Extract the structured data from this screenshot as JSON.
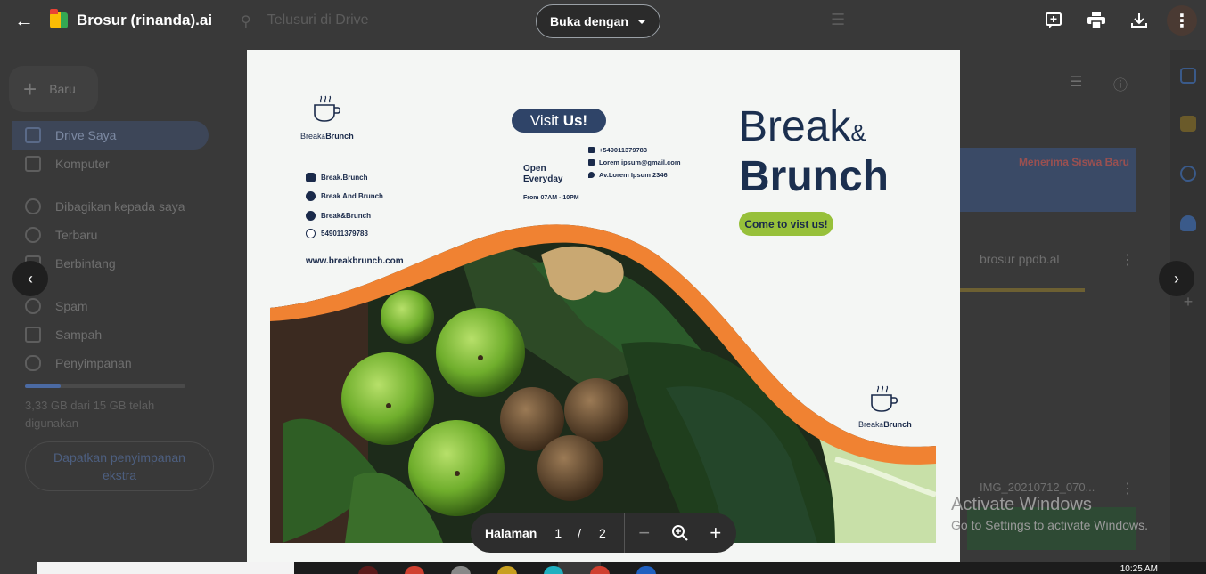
{
  "header": {
    "file_title": "Brosur (rinanda).ai",
    "search_placeholder": "Telusuri di Drive",
    "open_with_label": "Buka dengan"
  },
  "sidebar": {
    "new_label": "Baru",
    "items": [
      {
        "label": "Drive Saya",
        "icon": "drive-icon",
        "active": true
      },
      {
        "label": "Komputer",
        "icon": "computer-icon"
      },
      {
        "label": "Dibagikan kepada saya",
        "icon": "shared-icon"
      },
      {
        "label": "Terbaru",
        "icon": "clock-icon"
      },
      {
        "label": "Berbintang",
        "icon": "star-icon"
      },
      {
        "label": "Spam",
        "icon": "spam-icon"
      },
      {
        "label": "Sampah",
        "icon": "trash-icon"
      },
      {
        "label": "Penyimpanan",
        "icon": "cloud-icon"
      }
    ],
    "storage_text": "3,33 GB dari 15 GB telah digunakan",
    "get_storage": "Dapatkan penyimpanan ekstra",
    "storage_used_fraction": 0.22
  },
  "background_files": {
    "thumb_text": "Menerima Siswa Baru",
    "file1": "brosur ppdb.al",
    "file2": "IMG_20210712_070..."
  },
  "brochure": {
    "logo_small": {
      "pre": "Break",
      "amp": "&",
      "post": "Brunch"
    },
    "socials": [
      {
        "icon": "instagram-icon",
        "text": "Break.Brunch"
      },
      {
        "icon": "facebook-icon",
        "text": "Break And Brunch"
      },
      {
        "icon": "twitter-icon",
        "text": "Break&Brunch"
      },
      {
        "icon": "whatsapp-icon",
        "text": "549011379783"
      }
    ],
    "website": "www.breakbrunch.com",
    "visit": {
      "pre": "Visit",
      "bold": "Us!"
    },
    "open_label": "Open Everyday",
    "hours": "From 07AM - 10PM",
    "contacts": [
      {
        "icon": "phone-icon",
        "text": "+549011379783"
      },
      {
        "icon": "mail-icon",
        "text": "Lorem ipsum@gmail.com"
      },
      {
        "icon": "location-icon",
        "text": "Av.Lorem Ipsum 2346"
      }
    ],
    "brand_line1": "Break",
    "brand_amp": "&",
    "brand_line2": "Brunch",
    "cta": "Come to vist us!",
    "colors": {
      "navy": "#1b2f4f",
      "orange": "#f08232",
      "green": "#97c03a"
    }
  },
  "page_control": {
    "label": "Halaman",
    "current": "1",
    "separator": "/",
    "total": "2"
  },
  "watermark": {
    "title": "Activate Windows",
    "subtitle": "Go to Settings to activate Windows."
  },
  "taskbar": {
    "clock": "10:25 AM"
  }
}
